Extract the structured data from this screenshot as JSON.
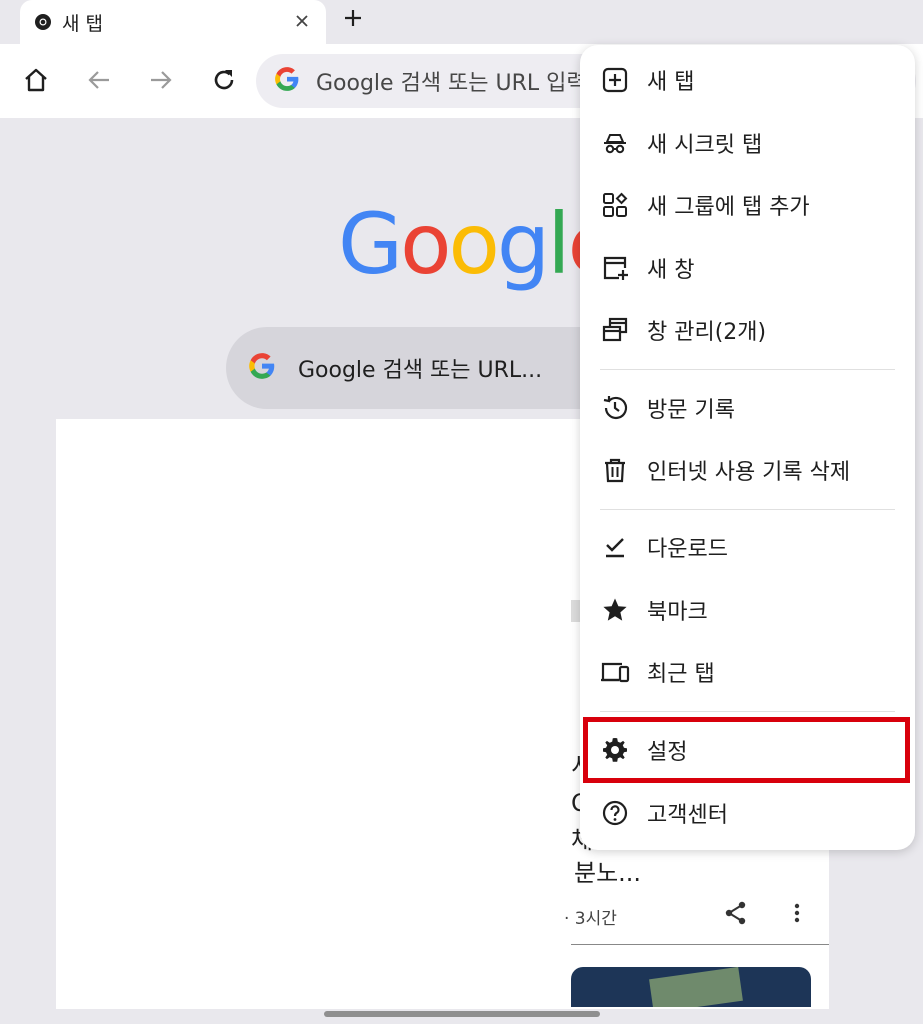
{
  "tab": {
    "title": "새 탭"
  },
  "toolbar": {
    "omnibox_text": "Google 검색 또는 URL 입력"
  },
  "ntp": {
    "logo": [
      "G",
      "o",
      "o",
      "g",
      "l",
      "e"
    ],
    "logo_colors": [
      "#4285f4",
      "#ea4335",
      "#fbbc05",
      "#4285f4",
      "#34a853",
      "#ea4335"
    ],
    "search_placeholder": "Google 검색 또는 URL..."
  },
  "feed": {
    "headline_lines": [
      "서",
      "O",
      "체",
      "분노..."
    ],
    "time": "· 3시간"
  },
  "menu": {
    "items": [
      {
        "label": "새 탭",
        "icon": "new-tab-icon"
      },
      {
        "label": "새 시크릿 탭",
        "icon": "incognito-icon"
      },
      {
        "label": "새 그룹에 탭 추가",
        "icon": "tab-group-icon"
      },
      {
        "label": "새 창",
        "icon": "new-window-icon"
      },
      {
        "label": "창 관리(2개)",
        "icon": "manage-windows-icon"
      },
      {
        "label": "방문 기록",
        "icon": "history-icon"
      },
      {
        "label": "인터넷 사용 기록 삭제",
        "icon": "trash-icon"
      },
      {
        "label": "다운로드",
        "icon": "download-icon"
      },
      {
        "label": "북마크",
        "icon": "star-icon"
      },
      {
        "label": "최근 탭",
        "icon": "recent-tabs-icon"
      },
      {
        "label": "설정",
        "icon": "gear-icon"
      },
      {
        "label": "고객센터",
        "icon": "help-icon"
      }
    ]
  },
  "colors": {
    "highlight": "#d8000c",
    "accent": "#1a73e8"
  }
}
